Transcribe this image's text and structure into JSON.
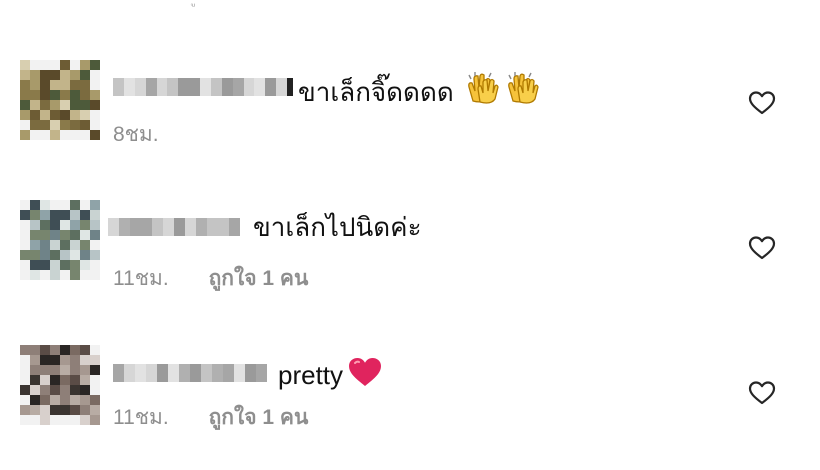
{
  "comments": [
    {
      "text": "ขาเล็กจิ๊ดดดด",
      "emojis": [
        "clapping-hands-icon",
        "clapping-hands-icon"
      ],
      "time": "8ชม.",
      "likes": ""
    },
    {
      "text": "ขาเล็กไปนิดค่ะ",
      "emojis": [],
      "time": "11ชม.",
      "likes": "ถูกใจ 1 คน"
    },
    {
      "text": "pretty",
      "emojis": [
        "red-heart-icon"
      ],
      "time": "11ชม.",
      "likes": "ถูกใจ 1 คน"
    }
  ],
  "colors": {
    "text": "#111111",
    "meta": "#8e8e8e",
    "heart_outline": "#262626",
    "heart_emoji": "#e0245e",
    "clap": "#f4b400"
  }
}
